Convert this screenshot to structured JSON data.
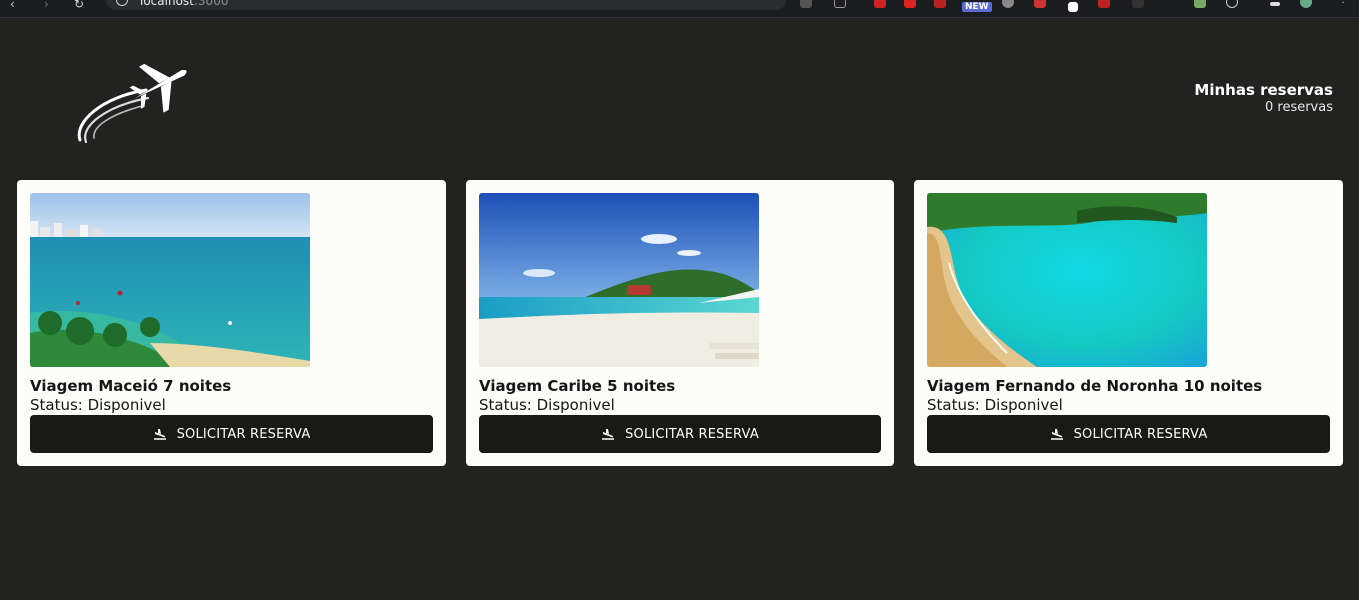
{
  "browser": {
    "url_host": "localhost",
    "url_port": ":3000",
    "new_badge": "NEW"
  },
  "header": {
    "logo_icon": "airplane-logo-icon",
    "cart_title": "Minhas reservas",
    "cart_count": "0 reservas"
  },
  "trips": [
    {
      "title": "Viagem Maceió 7 noites",
      "status": "Status: Disponivel",
      "button": "SOLICITAR RESERVA",
      "image": "maceio-beach-photo"
    },
    {
      "title": "Viagem Caribe 5 noites",
      "status": "Status: Disponivel",
      "button": "SOLICITAR RESERVA",
      "image": "caribe-beach-photo"
    },
    {
      "title": "Viagem Fernando de Noronha 10 noites",
      "status": "Status: Disponivel",
      "button": "SOLICITAR RESERVA",
      "image": "noronha-bay-photo"
    }
  ],
  "colors": {
    "page_bg": "#222220",
    "card_bg": "#fcfcf8",
    "button_bg": "#191916"
  }
}
